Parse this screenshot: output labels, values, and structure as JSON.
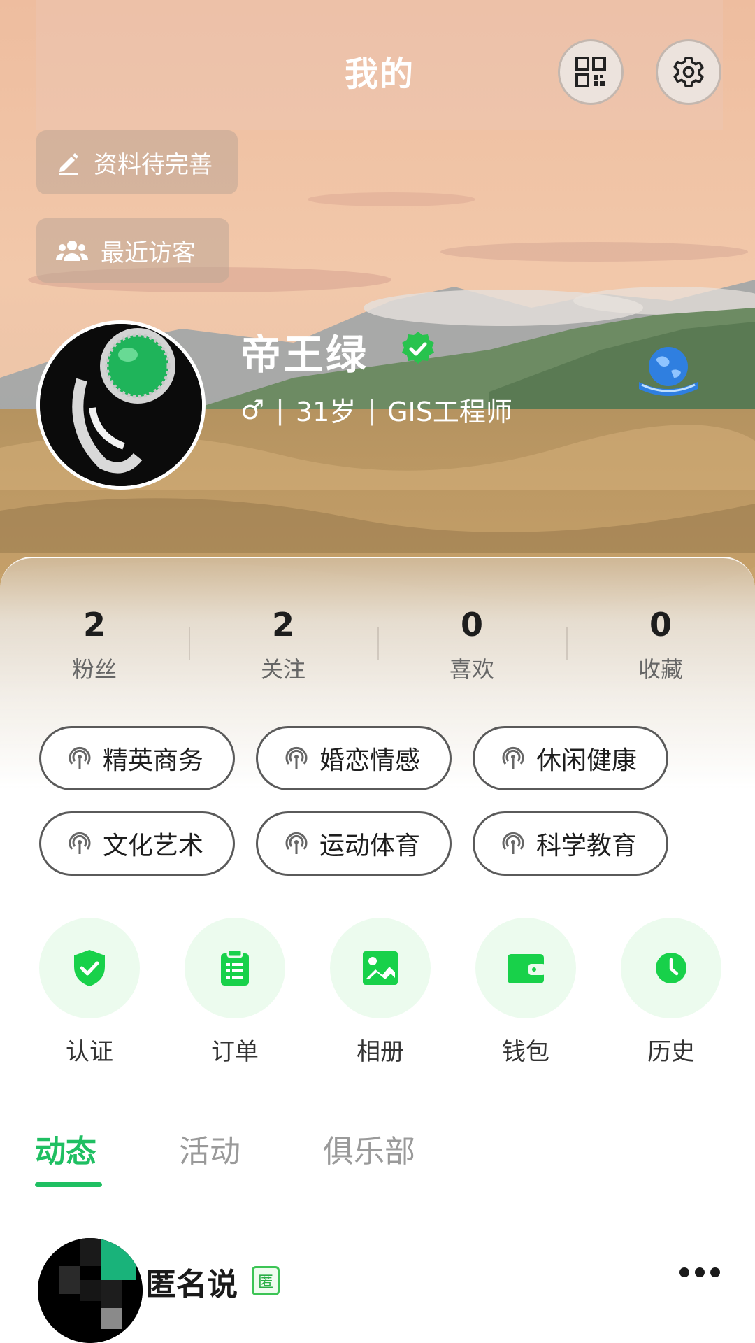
{
  "header": {
    "title": "我的"
  },
  "profile": {
    "edit_label": "资料待完善",
    "visitors_label": "最近访客",
    "name": "帝王绿",
    "gender_symbol": "♂",
    "age": "31岁",
    "occupation": "GIS工程师"
  },
  "stats": [
    {
      "value": "2",
      "label": "粉丝"
    },
    {
      "value": "2",
      "label": "关注"
    },
    {
      "value": "0",
      "label": "喜欢"
    },
    {
      "value": "0",
      "label": "收藏"
    }
  ],
  "tags": [
    "精英商务",
    "婚恋情感",
    "休闲健康",
    "文化艺术",
    "运动体育",
    "科学教育"
  ],
  "quick_actions": [
    {
      "label": "认证",
      "icon": "shield-check-icon"
    },
    {
      "label": "订单",
      "icon": "clipboard-icon"
    },
    {
      "label": "相册",
      "icon": "image-icon"
    },
    {
      "label": "钱包",
      "icon": "wallet-icon"
    },
    {
      "label": "历史",
      "icon": "clock-icon"
    }
  ],
  "tabs": [
    {
      "label": "动态",
      "active": true
    },
    {
      "label": "活动",
      "active": false
    },
    {
      "label": "俱乐部",
      "active": false
    }
  ],
  "post": {
    "author": "匿名说",
    "badge": "匿"
  },
  "colors": {
    "accent": "#1fbf62",
    "quick_bg": "#ecfbee",
    "verified": "#28c34e",
    "globe": "#2f7fe0"
  }
}
